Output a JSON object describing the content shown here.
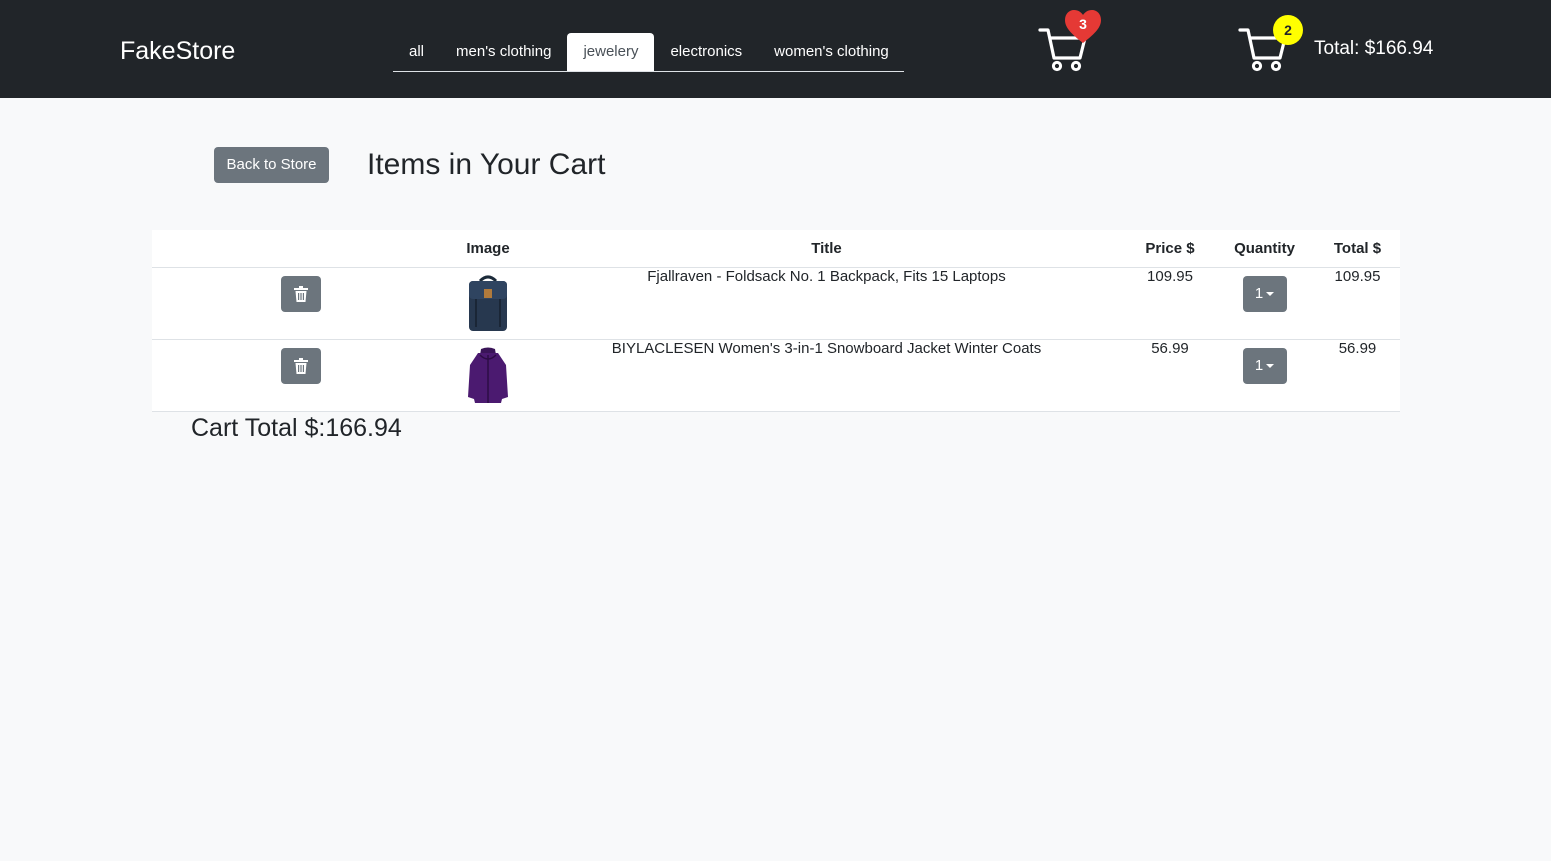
{
  "brand": "FakeStore",
  "tabs": [
    {
      "label": "all",
      "active": false
    },
    {
      "label": "men's clothing",
      "active": false
    },
    {
      "label": "jewelery",
      "active": true
    },
    {
      "label": "electronics",
      "active": false
    },
    {
      "label": "women's clothing",
      "active": false
    }
  ],
  "wishlist": {
    "count": "3",
    "icon": "heart-icon"
  },
  "cart": {
    "count": "2",
    "total_label": "Total: $166.94",
    "icon": "cart-icon"
  },
  "page": {
    "back_button": "Back to Store",
    "title": "Items in Your Cart",
    "cart_total": "Cart Total $:166.94"
  },
  "table": {
    "columns": [
      "",
      "Image",
      "Title",
      "Price $",
      "Quantity",
      "Total $"
    ],
    "rows": [
      {
        "image": "backpack",
        "title": "Fjallraven - Foldsack No. 1 Backpack, Fits 15 Laptops",
        "price": "109.95",
        "quantity": "1",
        "total": "109.95"
      },
      {
        "image": "jacket",
        "title": "BIYLACLESEN Women's 3-in-1 Snowboard Jacket Winter Coats",
        "price": "56.99",
        "quantity": "1",
        "total": "56.99"
      }
    ]
  },
  "colors": {
    "navbar": "#212529",
    "button": "#6c757d",
    "wishlist_badge": "#e53935",
    "cart_badge": "#ffff00",
    "page_bg": "#f8f9fa"
  }
}
